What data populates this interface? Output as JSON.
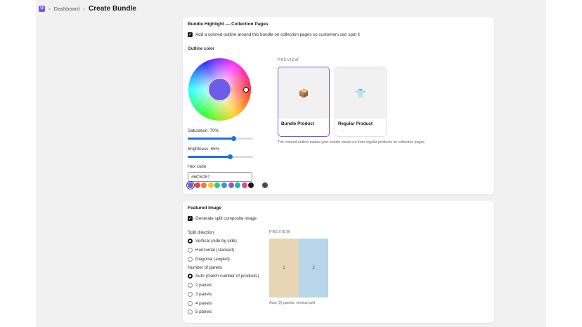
{
  "header": {
    "app_icon_letter": "U",
    "breadcrumb": "Dashboard",
    "title": "Create Bundle"
  },
  "highlight": {
    "title": "Bundle Highlight — Collection Pages",
    "checkbox_label": "Add a colored outline around this bundle on collection pages so customers can spot it",
    "checked": true,
    "outline_color_label": "Outline color",
    "saturation_label": "Saturation: 70%",
    "saturation_value": 70,
    "brightness_label": "Brightness: 65%",
    "brightness_value": 65,
    "hex_label": "Hex code",
    "hex_value": "#6C5CE7",
    "selected_color": "#6c5ce7",
    "swatches": [
      "#6c5ce7",
      "#e84545",
      "#f07a3a",
      "#f1c232",
      "#2ecc71",
      "#3498db",
      "#9b59b6",
      "#1abc9c",
      "#e84393",
      "#1a1a1a",
      "#ffffff",
      "#4a4a5a"
    ],
    "preview_heading": "PREVIEW",
    "products": [
      {
        "name": "Bundle Product",
        "price": "- - -",
        "icon": "📦"
      },
      {
        "name": "Regular Product",
        "price": "- -",
        "icon": "👕"
      }
    ],
    "preview_note": "The colored outline makes your bundle stand out from regular products on collection pages."
  },
  "featured": {
    "title": "Featured Image",
    "checkbox_label": "Generate split composite image",
    "checked": true,
    "split_direction_label": "Split direction",
    "split_options": [
      "Vertical (side by side)",
      "Horizontal (stacked)",
      "Diagonal (angled)"
    ],
    "split_selected": 0,
    "panels_label": "Number of panels",
    "panel_options": [
      "Auto (match number of products)",
      "2 panels",
      "3 panels",
      "4 panels",
      "5 panels"
    ],
    "panels_selected": 0,
    "preview_heading": "PREVIEW",
    "preview_panels": [
      "1",
      "2"
    ],
    "panel_colors": [
      "#e8d5b5",
      "#b8d6ea"
    ],
    "preview_note": "Auto (2) panels, vertical split"
  }
}
